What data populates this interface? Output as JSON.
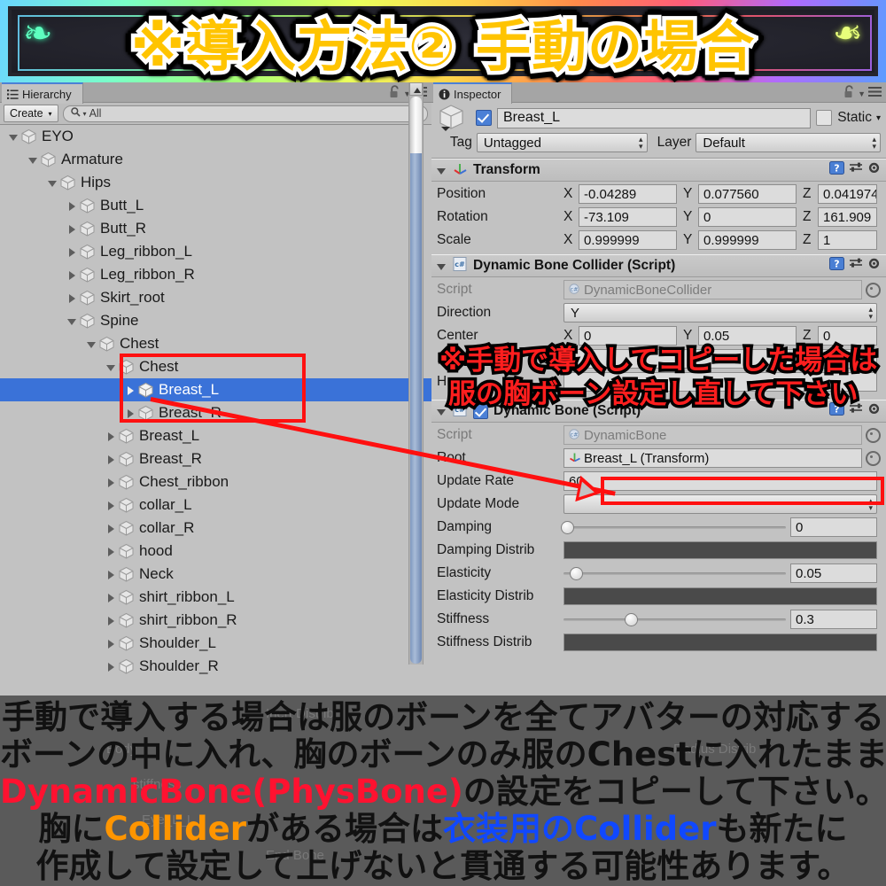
{
  "banner": {
    "title": "※導入方法② 手動の場合",
    "ornament_left": "❧",
    "ornament_right": "❧"
  },
  "hierarchy": {
    "tab_label": "Hierarchy",
    "tab_icon": "list-icon",
    "create_label": "Create",
    "create_caret": "▾",
    "search_prefix": "Q",
    "search_caret": "▾",
    "search_value": "All",
    "lock_icon": "lock-open-icon",
    "caret_icon": "chevron-down-icon",
    "menu_icon": "hamburger-menu-icon",
    "items": [
      {
        "label": "EYO",
        "depth": 0,
        "state": "open",
        "selected": false
      },
      {
        "label": "Armature",
        "depth": 1,
        "state": "open",
        "selected": false
      },
      {
        "label": "Hips",
        "depth": 2,
        "state": "open",
        "selected": false
      },
      {
        "label": "Butt_L",
        "depth": 3,
        "state": "closed",
        "selected": false
      },
      {
        "label": "Butt_R",
        "depth": 3,
        "state": "closed",
        "selected": false
      },
      {
        "label": "Leg_ribbon_L",
        "depth": 3,
        "state": "closed",
        "selected": false
      },
      {
        "label": "Leg_ribbon_R",
        "depth": 3,
        "state": "closed",
        "selected": false
      },
      {
        "label": "Skirt_root",
        "depth": 3,
        "state": "closed",
        "selected": false
      },
      {
        "label": "Spine",
        "depth": 3,
        "state": "open",
        "selected": false
      },
      {
        "label": "Chest",
        "depth": 4,
        "state": "open",
        "selected": false
      },
      {
        "label": "Chest",
        "depth": 5,
        "state": "open",
        "selected": false
      },
      {
        "label": "Breast_L",
        "depth": 6,
        "state": "closed",
        "selected": true
      },
      {
        "label": "Breast_R",
        "depth": 6,
        "state": "closed",
        "selected": false
      },
      {
        "label": "Breast_L",
        "depth": 5,
        "state": "closed",
        "selected": false
      },
      {
        "label": "Breast_R",
        "depth": 5,
        "state": "closed",
        "selected": false
      },
      {
        "label": "Chest_ribbon",
        "depth": 5,
        "state": "closed",
        "selected": false
      },
      {
        "label": "collar_L",
        "depth": 5,
        "state": "closed",
        "selected": false
      },
      {
        "label": "collar_R",
        "depth": 5,
        "state": "closed",
        "selected": false
      },
      {
        "label": "hood",
        "depth": 5,
        "state": "closed",
        "selected": false
      },
      {
        "label": "Neck",
        "depth": 5,
        "state": "closed",
        "selected": false
      },
      {
        "label": "shirt_ribbon_L",
        "depth": 5,
        "state": "closed",
        "selected": false
      },
      {
        "label": "shirt_ribbon_R",
        "depth": 5,
        "state": "closed",
        "selected": false
      },
      {
        "label": "Shoulder_L",
        "depth": 5,
        "state": "closed",
        "selected": false
      },
      {
        "label": "Shoulder_R",
        "depth": 5,
        "state": "closed",
        "selected": false
      }
    ]
  },
  "inspector": {
    "tab_label": "Inspector",
    "tab_icon": "info-icon",
    "lock_icon": "lock-open-icon",
    "menu_icon": "hamburger-menu-icon",
    "object_name": "Breast_L",
    "object_enabled": true,
    "static_label": "Static",
    "static_checked": false,
    "static_caret": "▾",
    "tag_label": "Tag",
    "tag_value": "Untagged",
    "layer_label": "Layer",
    "layer_value": "Default",
    "transform": {
      "title": "Transform",
      "icon": "transform-axis-icon",
      "rows": [
        {
          "name": "Position",
          "x": "-0.04289",
          "y": "0.077560",
          "z": "0.041974"
        },
        {
          "name": "Rotation",
          "x": "-73.109",
          "y": "0",
          "z": "161.909"
        },
        {
          "name": "Scale",
          "x": "0.999999",
          "y": "0.999999",
          "z": "1"
        }
      ]
    },
    "collider": {
      "title": "Dynamic Bone Collider (Script)",
      "icon": "csharp-script-icon",
      "script_label": "Script",
      "script_value": "DynamicBoneCollider",
      "direction_label": "Direction",
      "direction_value": "Y",
      "center_label": "Center",
      "center_x": "0",
      "center_y": "0.05",
      "center_z": "0",
      "radius_label": "R",
      "height_label": "H"
    },
    "dynamicbone": {
      "title": "Dynamic Bone (Script)",
      "icon": "csharp-script-icon",
      "enabled": true,
      "script_label": "Script",
      "script_value": "DynamicBone",
      "root_label": "Root",
      "root_value": "Breast_L (Transform)",
      "update_rate_label": "Update Rate",
      "update_rate_value": "60",
      "update_mode_label": "Update Mode",
      "update_mode_value": "",
      "sliders": [
        {
          "label": "Damping",
          "value": "0",
          "pct": 1
        },
        {
          "label": "Elasticity",
          "value": "0.05",
          "pct": 5
        },
        {
          "label": "Stiffness",
          "value": "0.3",
          "pct": 30
        }
      ],
      "curves": [
        "Damping Distrib",
        "Elasticity Distrib",
        "Stiffness Distrib"
      ]
    }
  },
  "annotations": {
    "inspector_note_line1": "※手動で導入してコピーした場合は",
    "inspector_note_line2": "服の胸ボーン設定し直して下さい",
    "highlight_box_hierarchy": "chest-breast-group",
    "highlight_box_root": "root-field",
    "arrow": "breast-l-to-root-arrow"
  },
  "caption": {
    "line1": [
      {
        "t": "手動で導入する場合は服のボーンを全てアバターの対応する",
        "c": "ck"
      }
    ],
    "line2": [
      {
        "t": "ボーンの中に入れ、胸のボーンのみ服のChestに入れたまま、",
        "c": "ck"
      }
    ],
    "line3": [
      {
        "t": "DynamicBone(PhysBone)",
        "c": "cr"
      },
      {
        "t": "の設定をコピーして下さい。",
        "c": "ck"
      }
    ],
    "line4": [
      {
        "t": "胸に",
        "c": "ck"
      },
      {
        "t": "Collider",
        "c": "co"
      },
      {
        "t": "がある場合は",
        "c": "ck"
      },
      {
        "t": "衣装用のCollider",
        "c": "cb"
      },
      {
        "t": "も新たに",
        "c": "ck"
      }
    ],
    "line5": [
      {
        "t": "作成して設定して上げないと貫通する可能性あります。",
        "c": "ck"
      }
    ]
  }
}
